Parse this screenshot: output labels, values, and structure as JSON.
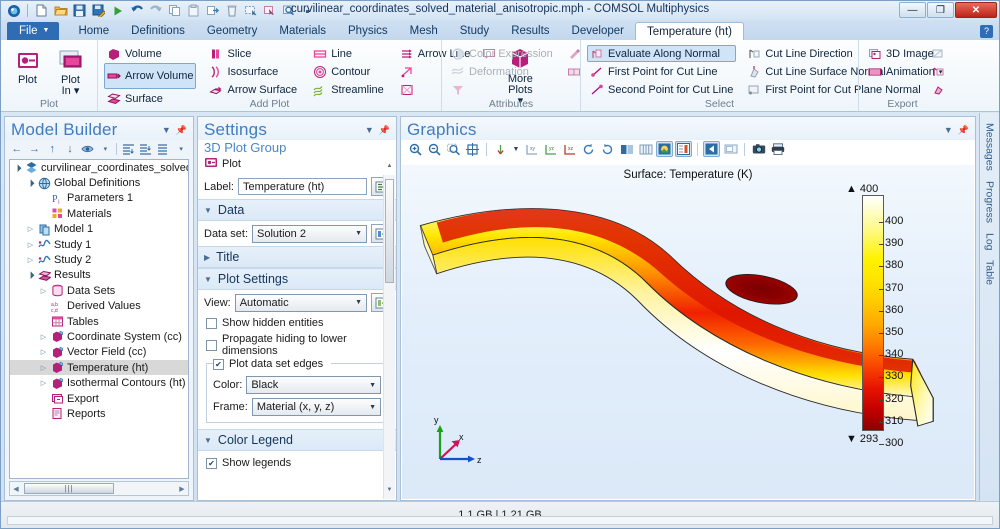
{
  "window": {
    "title": "curvilinear_coordinates_solved_material_anisotropic.mph - COMSOL Multiphysics",
    "minimize": "—",
    "maximize": "❐",
    "close": "✕"
  },
  "quick_access": [
    {
      "name": "comsol-logo-icon",
      "label": "COMSOL"
    },
    {
      "name": "new-file-icon",
      "label": "New"
    },
    {
      "name": "open-folder-icon",
      "label": "Open"
    },
    {
      "name": "save-icon",
      "label": "Save"
    },
    {
      "name": "save-as-icon",
      "label": "Save As"
    },
    {
      "name": "compute-run-icon",
      "label": "Compute"
    },
    {
      "name": "undo-icon",
      "label": "Undo"
    },
    {
      "name": "redo-icon",
      "label": "Redo"
    },
    {
      "name": "copy-icon",
      "label": "Copy"
    },
    {
      "name": "paste-icon",
      "label": "Paste"
    },
    {
      "name": "duplicate-icon",
      "label": "Duplicate"
    },
    {
      "name": "delete-icon",
      "label": "Delete"
    },
    {
      "name": "select-box-icon",
      "label": "Select Box"
    },
    {
      "name": "select-pointer-icon",
      "label": "Select"
    },
    {
      "name": "zoom-box-icon",
      "label": "Zoom Box"
    },
    {
      "name": "more-options-icon",
      "label": "More"
    }
  ],
  "ribbon": {
    "file_tab": "File",
    "tabs": [
      {
        "label": "Home",
        "active": false
      },
      {
        "label": "Definitions",
        "active": false
      },
      {
        "label": "Geometry",
        "active": false
      },
      {
        "label": "Materials",
        "active": false
      },
      {
        "label": "Physics",
        "active": false
      },
      {
        "label": "Mesh",
        "active": false
      },
      {
        "label": "Study",
        "active": false
      },
      {
        "label": "Results",
        "active": false
      },
      {
        "label": "Developer",
        "active": false
      },
      {
        "label": "Temperature (ht)",
        "active": true
      }
    ],
    "help_label": "?",
    "groups": [
      {
        "title": "Plot",
        "big_buttons": [
          {
            "label": "Plot",
            "icon": "plot-icon"
          },
          {
            "label": "Plot\nIn",
            "icon": "plot-in-icon",
            "dropdown": true
          }
        ]
      },
      {
        "title": "Add Plot",
        "columns": [
          [
            {
              "label": "Volume",
              "icon": "volume-plot-icon",
              "selected": false
            },
            {
              "label": "Arrow Volume",
              "icon": "arrow-volume-icon",
              "selected": true
            },
            {
              "label": "Surface",
              "icon": "surface-plot-icon",
              "selected": false
            }
          ],
          [
            {
              "label": "Slice",
              "icon": "slice-plot-icon",
              "selected": false
            },
            {
              "label": "Isosurface",
              "icon": "isosurface-icon",
              "selected": false
            },
            {
              "label": "Arrow Surface",
              "icon": "arrow-surface-icon",
              "selected": false
            }
          ],
          [
            {
              "label": "Line",
              "icon": "line-plot-icon",
              "selected": false
            },
            {
              "label": "Contour",
              "icon": "contour-plot-icon",
              "selected": false
            },
            {
              "label": "Streamline",
              "icon": "streamline-icon",
              "selected": false
            }
          ],
          [
            {
              "label": "Arrow Line",
              "icon": "arrow-line-icon",
              "selected": false
            },
            {
              "label": "",
              "icon": "arrow-point-icon",
              "selected": false
            },
            {
              "label": "",
              "icon": "particle-trace-icon",
              "selected": false
            }
          ]
        ],
        "extra_icons": [
          {
            "name": "annotation-icon"
          }
        ],
        "more_plots": {
          "label": "More\nPlots",
          "icon": "more-plots-icon"
        }
      },
      {
        "title": "Attributes",
        "items": [
          {
            "label": "Color Expression",
            "icon": "color-expression-icon",
            "disabled": true
          },
          {
            "label": "Deformation",
            "icon": "deformation-icon",
            "disabled": true
          },
          {
            "label": "",
            "icon": "filter-icon",
            "disabled": true
          }
        ],
        "side_icons": [
          {
            "name": "material-appearance-icon"
          },
          {
            "name": "transparency-icon"
          }
        ]
      },
      {
        "title": "Select",
        "columns": [
          [
            {
              "label": "Evaluate Along Normal",
              "icon": "evaluate-normal-icon",
              "selected": true
            },
            {
              "label": "First Point for Cut Line",
              "icon": "first-point-cut-line-icon",
              "selected": false
            },
            {
              "label": "Second Point for Cut Line",
              "icon": "second-point-cut-line-icon",
              "selected": false
            }
          ],
          [
            {
              "label": "Cut Line Direction",
              "icon": "cut-line-direction-icon",
              "selected": false
            },
            {
              "label": "Cut Line Surface Normal",
              "icon": "cut-line-surface-normal-icon",
              "selected": false
            },
            {
              "label": "First Point for Cut Plane Normal",
              "icon": "first-point-cut-plane-normal-icon",
              "selected": false
            }
          ]
        ],
        "trailing_icons": [
          {
            "name": "cut-plane-icon"
          },
          {
            "name": "cut-plane-normal-icon"
          },
          {
            "name": "cut-point-icon"
          }
        ]
      },
      {
        "title": "Export",
        "items": [
          {
            "label": "3D Image",
            "icon": "image-3d-icon"
          },
          {
            "label": "Animation",
            "icon": "animation-icon",
            "dropdown": true
          }
        ]
      }
    ]
  },
  "model_builder": {
    "title": "Model Builder",
    "toolbar": [
      {
        "name": "back-arrow-icon",
        "glyph": "←"
      },
      {
        "name": "forward-arrow-icon",
        "glyph": "→"
      },
      {
        "name": "move-up-icon",
        "glyph": "↑"
      },
      {
        "name": "move-down-icon",
        "glyph": "↓"
      },
      {
        "name": "show-hide-icon",
        "glyph": "◕"
      },
      {
        "name": "show-hide-dropdown-icon",
        "glyph": "▾"
      },
      {
        "name": "collapse-all-icon",
        "glyph": "⇥"
      },
      {
        "name": "expand-all-icon",
        "glyph": "⇤"
      },
      {
        "name": "node-options-icon",
        "glyph": "☰"
      },
      {
        "name": "node-options-dropdown-icon",
        "glyph": "▾"
      }
    ],
    "tree": [
      {
        "label": "curvilinear_coordinates_solved_m",
        "depth": 0,
        "twist": "expanded",
        "icon": "model-root-icon"
      },
      {
        "label": "Global Definitions",
        "depth": 1,
        "twist": "expanded",
        "icon": "global-definitions-icon"
      },
      {
        "label": "Parameters 1",
        "depth": 2,
        "twist": "none",
        "icon": "parameters-icon"
      },
      {
        "label": "Materials",
        "depth": 2,
        "twist": "none",
        "icon": "materials-icon"
      },
      {
        "label": "Model 1",
        "depth": 1,
        "twist": "collapsed",
        "icon": "component-icon"
      },
      {
        "label": "Study 1",
        "depth": 1,
        "twist": "collapsed",
        "icon": "study-icon"
      },
      {
        "label": "Study 2",
        "depth": 1,
        "twist": "collapsed",
        "icon": "study-icon"
      },
      {
        "label": "Results",
        "depth": 1,
        "twist": "expanded",
        "icon": "results-icon"
      },
      {
        "label": "Data Sets",
        "depth": 2,
        "twist": "collapsed",
        "icon": "data-sets-icon"
      },
      {
        "label": "Derived Values",
        "depth": 2,
        "twist": "none",
        "icon": "derived-values-icon"
      },
      {
        "label": "Tables",
        "depth": 2,
        "twist": "none",
        "icon": "tables-icon"
      },
      {
        "label": "Coordinate System (cc)",
        "depth": 2,
        "twist": "collapsed",
        "icon": "plot-group-icon"
      },
      {
        "label": "Vector Field (cc)",
        "depth": 2,
        "twist": "collapsed",
        "icon": "plot-group-icon"
      },
      {
        "label": "Temperature (ht)",
        "depth": 2,
        "twist": "collapsed",
        "icon": "plot-group-icon",
        "selected": true
      },
      {
        "label": "Isothermal Contours (ht)",
        "depth": 2,
        "twist": "collapsed",
        "icon": "plot-group-icon"
      },
      {
        "label": "Export",
        "depth": 2,
        "twist": "none",
        "icon": "export-icon"
      },
      {
        "label": "Reports",
        "depth": 2,
        "twist": "none",
        "icon": "reports-icon"
      }
    ]
  },
  "settings": {
    "title": "Settings",
    "subtitle": "3D Plot Group",
    "plot_button": "Plot",
    "label_field": {
      "label": "Label:",
      "value": "Temperature (ht)"
    },
    "sections": {
      "data": {
        "title": "Data",
        "data_set": {
          "label": "Data set:",
          "value": "Solution 2"
        }
      },
      "title_section": {
        "title": "Title"
      },
      "plot_settings": {
        "title": "Plot Settings",
        "view": {
          "label": "View:",
          "value": "Automatic"
        },
        "show_hidden_entities": {
          "label": "Show hidden entities",
          "checked": false
        },
        "propagate_hiding": {
          "label": "Propagate hiding to lower dimensions",
          "checked": false
        },
        "plot_data_set_edges": {
          "label": "Plot data set edges",
          "checked": true
        },
        "color": {
          "label": "Color:",
          "value": "Black"
        },
        "frame": {
          "label": "Frame:",
          "value": "Material  (x, y, z)"
        }
      },
      "color_legend": {
        "title": "Color Legend",
        "show_legends": {
          "label": "Show legends",
          "checked": true
        }
      }
    }
  },
  "graphics": {
    "title": "Graphics",
    "toolbar": [
      {
        "name": "zoom-in-icon"
      },
      {
        "name": "zoom-out-icon"
      },
      {
        "name": "zoom-box-icon"
      },
      {
        "name": "zoom-extents-icon"
      },
      {
        "name": "go-to-default-view-icon"
      },
      {
        "name": "view-dropdown-icon"
      },
      {
        "name": "go-to-xy-view-icon"
      },
      {
        "name": "go-to-yz-view-icon"
      },
      {
        "name": "go-to-xz-view-icon"
      },
      {
        "name": "rotate-ccw-icon"
      },
      {
        "name": "rotate-cw-icon"
      },
      {
        "name": "transparency-icon"
      },
      {
        "name": "wireframe-icon"
      },
      {
        "name": "scene-light-icon"
      },
      {
        "name": "show-color-legend-icon"
      },
      {
        "name": "select-all-icon"
      },
      {
        "name": "clear-selection-icon"
      },
      {
        "name": "snapshot-camera-icon"
      },
      {
        "name": "print-icon"
      }
    ],
    "plot_title": "Surface: Temperature (K)",
    "axis_triad": {
      "x": "x",
      "y": "y",
      "z": "z"
    }
  },
  "chart_data": {
    "type": "heatmap",
    "title": "Surface: Temperature (K)",
    "colorbar": {
      "unit": "K",
      "max_annotation": "400",
      "min_annotation": "293",
      "ticks": [
        "400",
        "390",
        "380",
        "370",
        "360",
        "350",
        "340",
        "330",
        "320",
        "310",
        "300"
      ],
      "range": [
        293,
        400
      ],
      "colormap": "Thermal",
      "colors": [
        "#8c0000",
        "#c40000",
        "#e81400",
        "#f94400",
        "#ff7a00",
        "#ffa800",
        "#ffcc00",
        "#ffe400",
        "#fff200",
        "#fff980",
        "#ffffff"
      ]
    },
    "description": "3D surface temperature field on an S-shaped curved bar; hot core (~400 K, dark red) along the inner curve, cooling to white/pale yellow (~293 K) at the outer edges."
  },
  "side_tabs": [
    {
      "label": "Messages"
    },
    {
      "label": "Progress"
    },
    {
      "label": "Log"
    },
    {
      "label": "Table"
    }
  ],
  "status_bar": {
    "memory": "1.1 GB | 1.21 GB"
  }
}
